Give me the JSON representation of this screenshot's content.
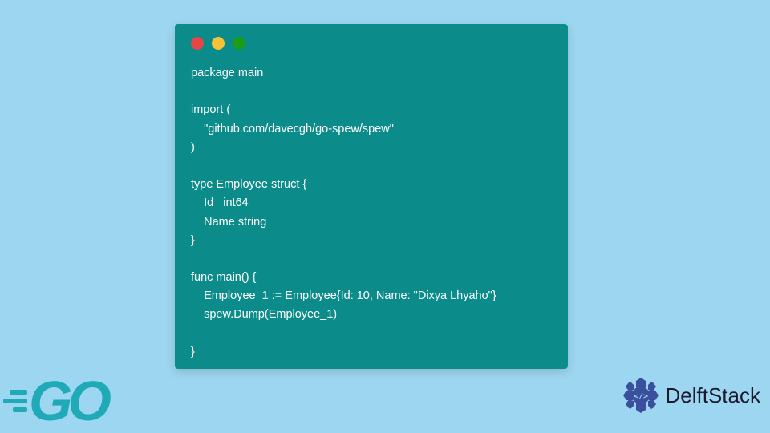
{
  "code": {
    "line1": "package main",
    "line2": "",
    "line3": "import (",
    "line4": "    \"github.com/davecgh/go-spew/spew\"",
    "line5": ")",
    "line6": "",
    "line7": "type Employee struct {",
    "line8": "    Id   int64",
    "line9": "    Name string",
    "line10": "}",
    "line11": "",
    "line12": "func main() {",
    "line13": "    Employee_1 := Employee{Id: 10, Name: \"Dixya Lhyaho\"}",
    "line14": "    spew.Dump(Employee_1)",
    "line15": "",
    "line16": "}"
  },
  "logo": {
    "go": "GO",
    "delft": "Delft",
    "stack": "Stack"
  }
}
